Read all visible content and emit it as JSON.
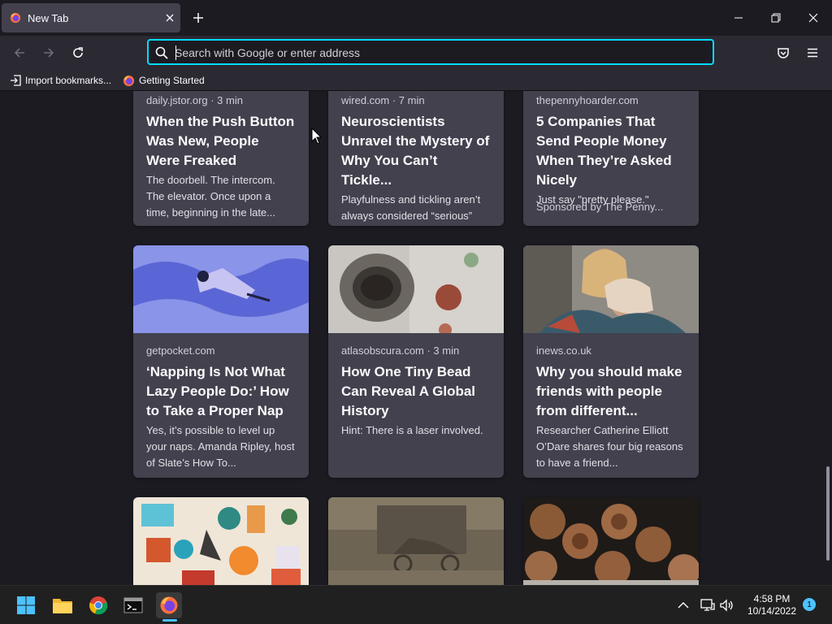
{
  "browser": {
    "tab": {
      "title": "New Tab"
    },
    "urlbar": {
      "placeholder": "Search with Google or enter address"
    },
    "bookmarks": [
      {
        "label": "Import bookmarks...",
        "icon": "import-icon"
      },
      {
        "label": "Getting Started",
        "icon": "firefox-icon"
      }
    ]
  },
  "stories": [
    {
      "source": "daily.jstor.org · 3 min",
      "title": "When the Push Button Was New, People Were Freaked",
      "excerpt": "The doorbell. The intercom. The elevator. Once upon a time, beginning in the late..."
    },
    {
      "source": "wired.com · 7 min",
      "title": "Neuroscientists Unravel the Mystery of Why You Can’t Tickle...",
      "excerpt": "Playfulness and tickling aren’t always considered “serious” subjects, but a new study..."
    },
    {
      "source": "thepennyhoarder.com",
      "title": "5 Companies That Send People Money When They’re Asked Nicely",
      "excerpt": "Just say \"pretty please.\"",
      "sponsor": "Sponsored by The Penny..."
    },
    {
      "source": "getpocket.com",
      "title": "‘Napping Is Not What Lazy People Do:’ How to Take a Proper Nap",
      "excerpt": "Yes, it’s possible to level up your naps. Amanda Ripley, host of Slate’s How To..."
    },
    {
      "source": "atlasobscura.com · 3 min",
      "title": "How One Tiny Bead Can Reveal A Global History",
      "excerpt": "Hint: There is a laser involved."
    },
    {
      "source": "inews.co.uk",
      "title": "Why you should make friends with people from different...",
      "excerpt": "Researcher Catherine Elliott O’Dare shares four big reasons to have a friend..."
    }
  ],
  "taskbar": {
    "apps": [
      "windows-start-icon",
      "file-explorer-icon",
      "chrome-icon",
      "terminal-icon",
      "firefox-icon"
    ],
    "clock": {
      "time": "4:58 PM",
      "date": "10/14/2022"
    },
    "notifications": "1"
  },
  "colors": {
    "accent": "#00ddff",
    "background": "#1c1b22",
    "card": "#42414d",
    "toolbar": "#2b2a33"
  }
}
